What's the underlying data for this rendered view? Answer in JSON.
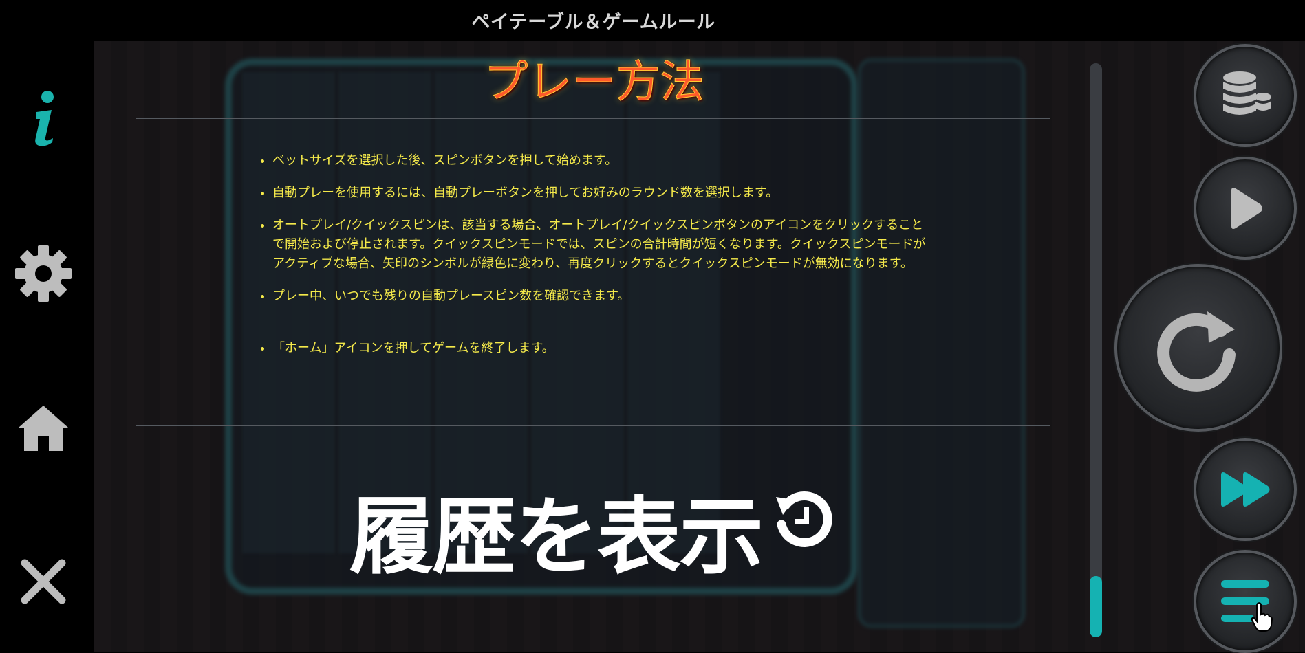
{
  "header": {
    "title": "ペイテーブル＆ゲームルール"
  },
  "sidebar": {
    "items": [
      {
        "name": "info",
        "icon": "info-icon",
        "color": "#1ab3ad"
      },
      {
        "name": "settings",
        "icon": "gear-icon",
        "color": "#bdbdbd"
      },
      {
        "name": "home",
        "icon": "home-icon",
        "color": "#bdbdbd"
      },
      {
        "name": "close",
        "icon": "close-icon",
        "color": "#bdbdbd"
      }
    ]
  },
  "content": {
    "title": "プレー方法",
    "rules": [
      "ベットサイズを選択した後、スピンボタンを押して始めます。",
      "自動プレーを使用するには、自動プレーボタンを押してお好みのラウンド数を選択します。",
      "オートプレイ/クイックスピンは、該当する場合、オートプレイ/クイックスピンボタンのアイコンをクリックすることで開始および停止されます。クイックスピンモードでは、スピンの合計時間が短くなります。クイックスピンモードがアクティブな場合、矢印のシンボルが緑色に変わり、再度クリックするとクイックスピンモードが無効になります。",
      "プレー中、いつでも残りの自動プレースピン数を確認できます。",
      "「ホーム」アイコンを押してゲームを終了します。"
    ],
    "history_label": "履歴を表示"
  },
  "controls": {
    "bet_icon": "coins-icon",
    "autoplay_icon": "play-icon",
    "spin_icon": "spin-arrow-icon",
    "quickspin_icon": "fast-forward-icon",
    "menu_icon": "menu-icon",
    "accent": "#15b2b2"
  },
  "scroll": {
    "position": 1.0
  }
}
